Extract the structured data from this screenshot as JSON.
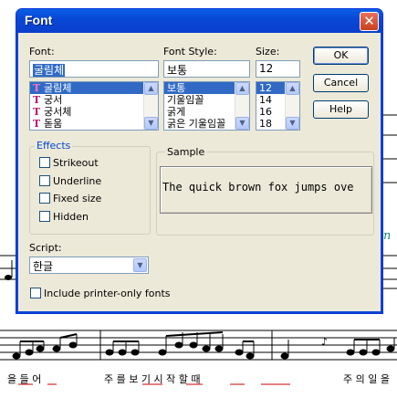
{
  "dialog": {
    "title": "Font",
    "close_glyph": "✕",
    "font_label": "Font:",
    "font_value": "굴림체",
    "font_list": [
      "굴림체",
      "궁서",
      "궁서체",
      "돋움"
    ],
    "style_label": "Font Style:",
    "style_value": "보통",
    "style_list": [
      "보통",
      "기울임꼴",
      "굵게",
      "굵은 기울임꼴"
    ],
    "size_label": "Size:",
    "size_value": "12",
    "size_list": [
      "12",
      "14",
      "16",
      "18"
    ],
    "ok_label": "OK",
    "cancel_label": "Cancel",
    "help_label": "Help",
    "effects_label": "Effects",
    "effects": [
      "Strikeout",
      "Underline",
      "Fixed size",
      "Hidden"
    ],
    "sample_label": "Sample",
    "sample_text": "The quick brown fox jumps ove",
    "script_label": "Script:",
    "script_value": "한글",
    "printer_fonts_label": "Include printer-only fonts"
  },
  "score": {
    "lyrics_left": "을 들   어",
    "lyrics_mid": "주 를 보   기 시   작 할   때",
    "lyrics_right": "주 의 일 을"
  },
  "colors": {
    "title_bar": "#0a5fe5",
    "selection": "#316ac5",
    "group_title": "#0046d5",
    "lyric_underline": "#cc0000"
  }
}
